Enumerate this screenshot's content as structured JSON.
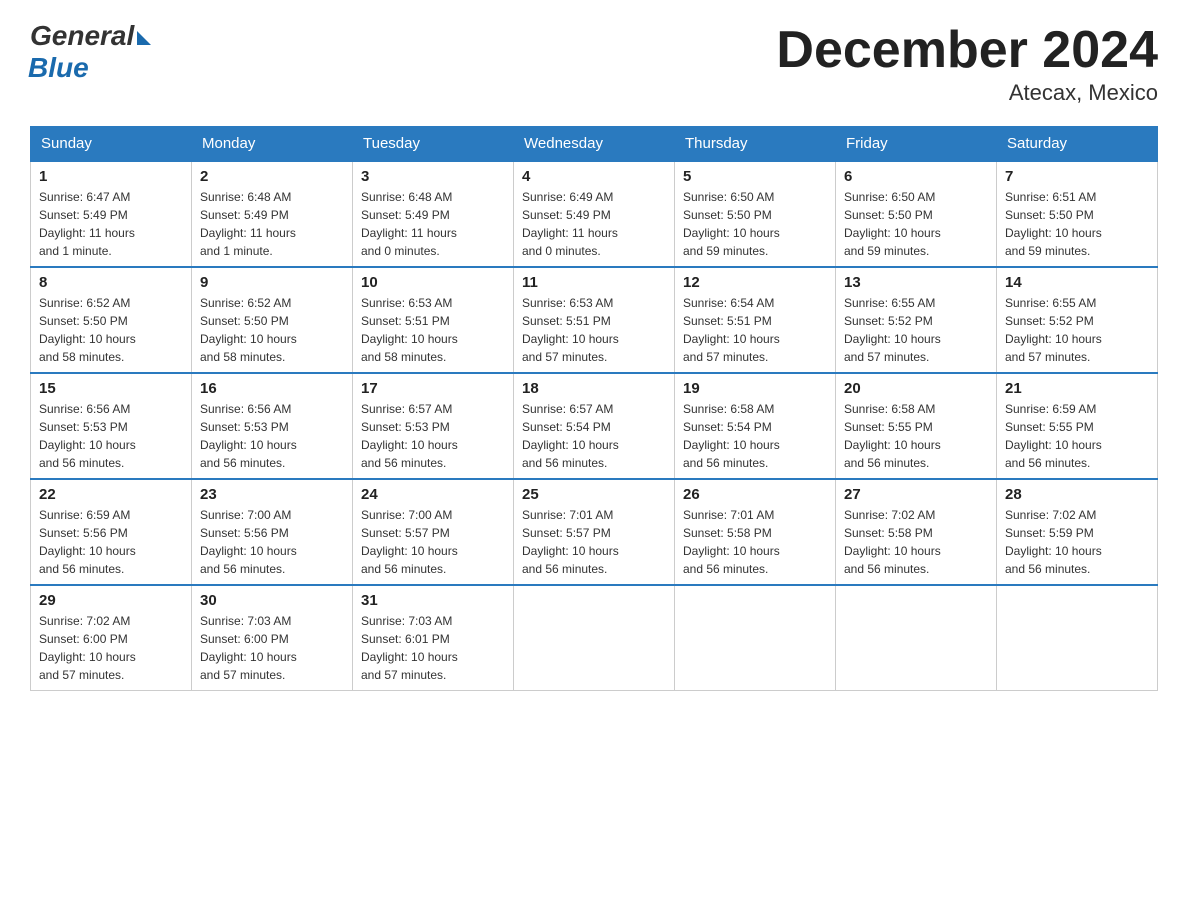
{
  "logo": {
    "general": "General",
    "blue": "Blue"
  },
  "title": "December 2024",
  "location": "Atecax, Mexico",
  "days_of_week": [
    "Sunday",
    "Monday",
    "Tuesday",
    "Wednesday",
    "Thursday",
    "Friday",
    "Saturday"
  ],
  "weeks": [
    [
      {
        "day": "1",
        "info": "Sunrise: 6:47 AM\nSunset: 5:49 PM\nDaylight: 11 hours\nand 1 minute."
      },
      {
        "day": "2",
        "info": "Sunrise: 6:48 AM\nSunset: 5:49 PM\nDaylight: 11 hours\nand 1 minute."
      },
      {
        "day": "3",
        "info": "Sunrise: 6:48 AM\nSunset: 5:49 PM\nDaylight: 11 hours\nand 0 minutes."
      },
      {
        "day": "4",
        "info": "Sunrise: 6:49 AM\nSunset: 5:49 PM\nDaylight: 11 hours\nand 0 minutes."
      },
      {
        "day": "5",
        "info": "Sunrise: 6:50 AM\nSunset: 5:50 PM\nDaylight: 10 hours\nand 59 minutes."
      },
      {
        "day": "6",
        "info": "Sunrise: 6:50 AM\nSunset: 5:50 PM\nDaylight: 10 hours\nand 59 minutes."
      },
      {
        "day": "7",
        "info": "Sunrise: 6:51 AM\nSunset: 5:50 PM\nDaylight: 10 hours\nand 59 minutes."
      }
    ],
    [
      {
        "day": "8",
        "info": "Sunrise: 6:52 AM\nSunset: 5:50 PM\nDaylight: 10 hours\nand 58 minutes."
      },
      {
        "day": "9",
        "info": "Sunrise: 6:52 AM\nSunset: 5:50 PM\nDaylight: 10 hours\nand 58 minutes."
      },
      {
        "day": "10",
        "info": "Sunrise: 6:53 AM\nSunset: 5:51 PM\nDaylight: 10 hours\nand 58 minutes."
      },
      {
        "day": "11",
        "info": "Sunrise: 6:53 AM\nSunset: 5:51 PM\nDaylight: 10 hours\nand 57 minutes."
      },
      {
        "day": "12",
        "info": "Sunrise: 6:54 AM\nSunset: 5:51 PM\nDaylight: 10 hours\nand 57 minutes."
      },
      {
        "day": "13",
        "info": "Sunrise: 6:55 AM\nSunset: 5:52 PM\nDaylight: 10 hours\nand 57 minutes."
      },
      {
        "day": "14",
        "info": "Sunrise: 6:55 AM\nSunset: 5:52 PM\nDaylight: 10 hours\nand 57 minutes."
      }
    ],
    [
      {
        "day": "15",
        "info": "Sunrise: 6:56 AM\nSunset: 5:53 PM\nDaylight: 10 hours\nand 56 minutes."
      },
      {
        "day": "16",
        "info": "Sunrise: 6:56 AM\nSunset: 5:53 PM\nDaylight: 10 hours\nand 56 minutes."
      },
      {
        "day": "17",
        "info": "Sunrise: 6:57 AM\nSunset: 5:53 PM\nDaylight: 10 hours\nand 56 minutes."
      },
      {
        "day": "18",
        "info": "Sunrise: 6:57 AM\nSunset: 5:54 PM\nDaylight: 10 hours\nand 56 minutes."
      },
      {
        "day": "19",
        "info": "Sunrise: 6:58 AM\nSunset: 5:54 PM\nDaylight: 10 hours\nand 56 minutes."
      },
      {
        "day": "20",
        "info": "Sunrise: 6:58 AM\nSunset: 5:55 PM\nDaylight: 10 hours\nand 56 minutes."
      },
      {
        "day": "21",
        "info": "Sunrise: 6:59 AM\nSunset: 5:55 PM\nDaylight: 10 hours\nand 56 minutes."
      }
    ],
    [
      {
        "day": "22",
        "info": "Sunrise: 6:59 AM\nSunset: 5:56 PM\nDaylight: 10 hours\nand 56 minutes."
      },
      {
        "day": "23",
        "info": "Sunrise: 7:00 AM\nSunset: 5:56 PM\nDaylight: 10 hours\nand 56 minutes."
      },
      {
        "day": "24",
        "info": "Sunrise: 7:00 AM\nSunset: 5:57 PM\nDaylight: 10 hours\nand 56 minutes."
      },
      {
        "day": "25",
        "info": "Sunrise: 7:01 AM\nSunset: 5:57 PM\nDaylight: 10 hours\nand 56 minutes."
      },
      {
        "day": "26",
        "info": "Sunrise: 7:01 AM\nSunset: 5:58 PM\nDaylight: 10 hours\nand 56 minutes."
      },
      {
        "day": "27",
        "info": "Sunrise: 7:02 AM\nSunset: 5:58 PM\nDaylight: 10 hours\nand 56 minutes."
      },
      {
        "day": "28",
        "info": "Sunrise: 7:02 AM\nSunset: 5:59 PM\nDaylight: 10 hours\nand 56 minutes."
      }
    ],
    [
      {
        "day": "29",
        "info": "Sunrise: 7:02 AM\nSunset: 6:00 PM\nDaylight: 10 hours\nand 57 minutes."
      },
      {
        "day": "30",
        "info": "Sunrise: 7:03 AM\nSunset: 6:00 PM\nDaylight: 10 hours\nand 57 minutes."
      },
      {
        "day": "31",
        "info": "Sunrise: 7:03 AM\nSunset: 6:01 PM\nDaylight: 10 hours\nand 57 minutes."
      },
      {
        "day": "",
        "info": ""
      },
      {
        "day": "",
        "info": ""
      },
      {
        "day": "",
        "info": ""
      },
      {
        "day": "",
        "info": ""
      }
    ]
  ]
}
